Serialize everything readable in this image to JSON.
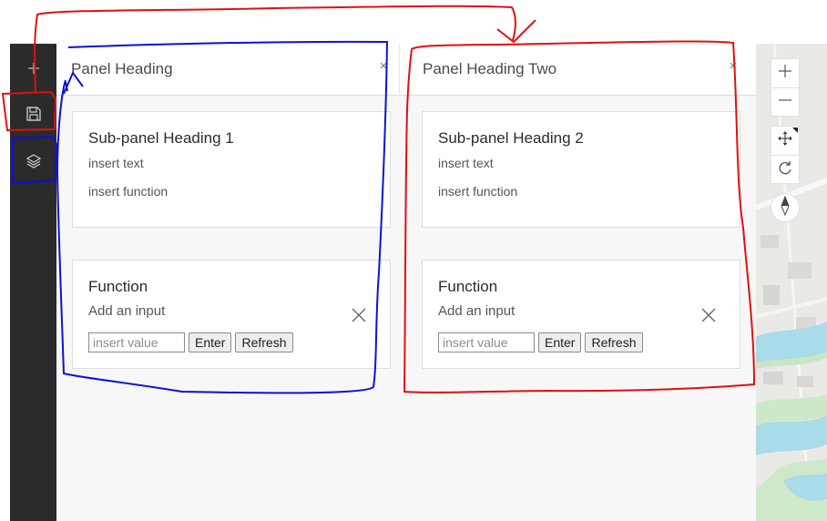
{
  "action_bar": {
    "items": [
      {
        "icon": "plus-icon"
      },
      {
        "icon": "save-icon"
      },
      {
        "icon": "layers-icon"
      }
    ]
  },
  "panels": [
    {
      "heading": "Panel Heading",
      "close_glyph": "×",
      "subpanel": {
        "heading": "Sub-panel Heading 1",
        "text": "insert text",
        "function_text": "insert function"
      },
      "function_card": {
        "heading": "Function",
        "text": "Add an input",
        "input_placeholder": "insert value",
        "enter_label": "Enter",
        "refresh_label": "Refresh"
      }
    },
    {
      "heading": "Panel Heading Two",
      "close_glyph": "×",
      "subpanel": {
        "heading": "Sub-panel Heading 2",
        "text": "insert text",
        "function_text": "insert function"
      },
      "function_card": {
        "heading": "Function",
        "text": "Add an input",
        "input_placeholder": "insert value",
        "enter_label": "Enter",
        "refresh_label": "Refresh"
      }
    }
  ],
  "map_controls": [
    "zoom-in-icon",
    "zoom-out-icon",
    "pan-icon",
    "rotate-icon",
    "compass-icon"
  ],
  "colors": {
    "action_bar": "#2b2b2b",
    "annotation_red": "#e01010",
    "annotation_blue": "#1010d8",
    "map_water": "#a9dbe8",
    "map_land": "#e9e9e6"
  }
}
